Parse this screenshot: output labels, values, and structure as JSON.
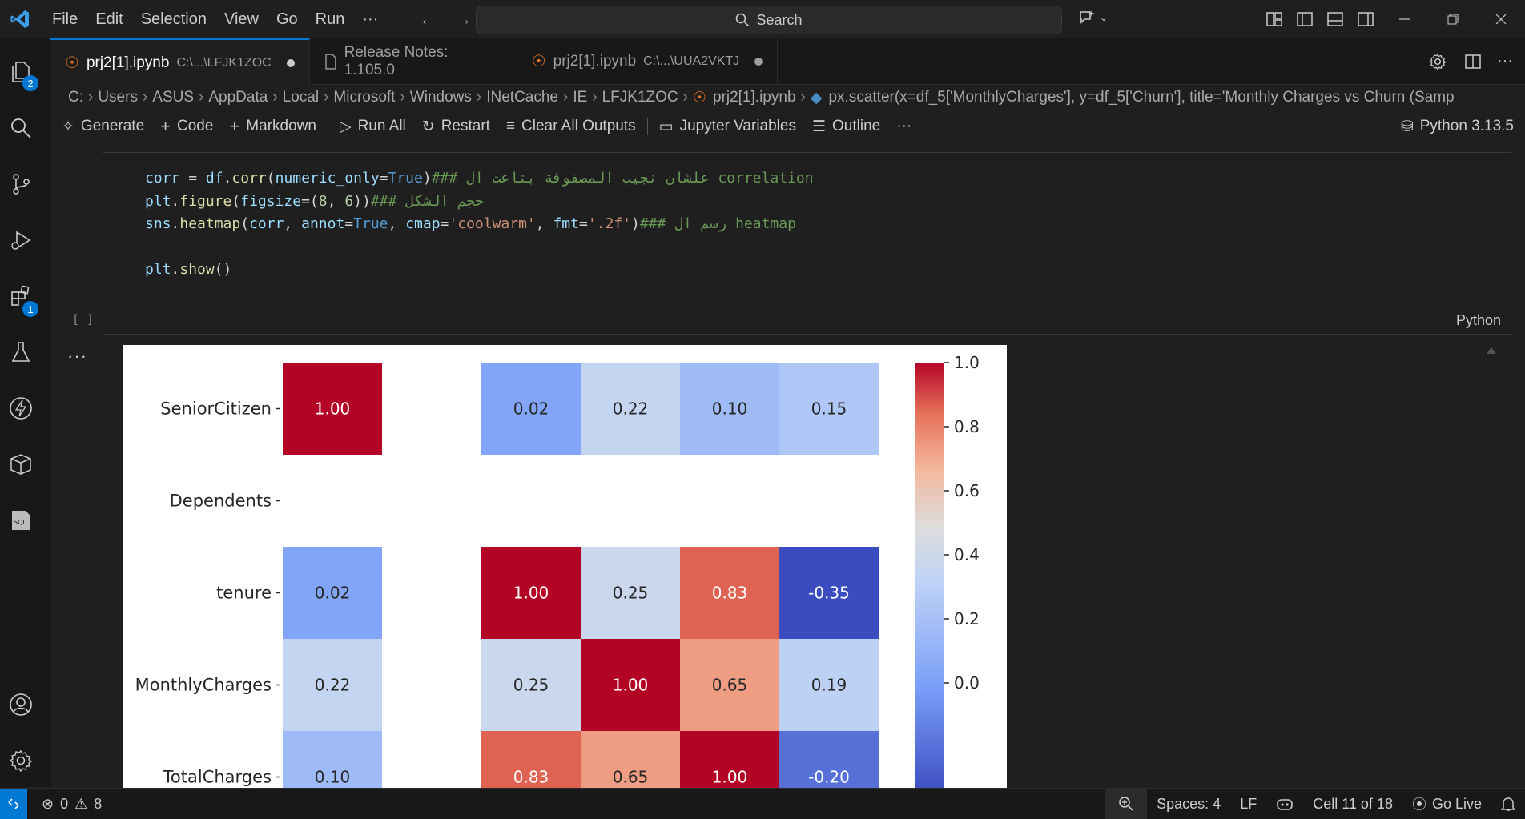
{
  "titlebar": {
    "menu": [
      "File",
      "Edit",
      "Selection",
      "View",
      "Go",
      "Run",
      "···"
    ],
    "search_placeholder": "Search"
  },
  "activity_badges": {
    "explorer": "2",
    "extensions": "1"
  },
  "tabs": [
    {
      "name": "prj2[1].ipynb",
      "path": "C:\\...\\LFJK1ZOC",
      "active": true,
      "modified": true
    },
    {
      "name": "Release Notes: 1.105.0",
      "path": "",
      "active": false,
      "modified": false
    },
    {
      "name": "prj2[1].ipynb",
      "path": "C:\\...\\UUA2VKTJ",
      "active": false,
      "modified": true
    }
  ],
  "breadcrumb": [
    "C:",
    "Users",
    "ASUS",
    "AppData",
    "Local",
    "Microsoft",
    "Windows",
    "INetCache",
    "IE",
    "LFJK1ZOC",
    "prj2[1].ipynb",
    "px.scatter(x=df_5['MonthlyCharges'], y=df_5['Churn'], title='Monthly Charges vs Churn (Samp"
  ],
  "notebook_toolbar": {
    "generate": "Generate",
    "code": "Code",
    "markdown": "Markdown",
    "run_all": "Run All",
    "restart": "Restart",
    "clear_outputs": "Clear All Outputs",
    "variables": "Jupyter Variables",
    "outline": "Outline",
    "more": "···",
    "kernel": "Python 3.13.5"
  },
  "cell": {
    "execution_count": "[ ]",
    "language": "Python",
    "code_lines": [
      "corr = df.corr(numeric_only=True)### علشان نجيب المصفوفة بتاعت ال correlation",
      "plt.figure(figsize=(8, 6))### حجم الشكل",
      "sns.heatmap(corr, annot=True, cmap='coolwarm', fmt='.2f')### رسم ال heatmap",
      "",
      "plt.show()"
    ]
  },
  "output_more": "···",
  "chart_data": {
    "type": "heatmap",
    "rows": [
      "SeniorCitizen",
      "Dependents",
      "tenure",
      "MonthlyCharges",
      "TotalCharges"
    ],
    "column_count_visible": 5,
    "cells": [
      [
        1.0,
        null,
        0.02,
        0.22,
        0.1,
        0.15
      ],
      [
        null,
        null,
        null,
        null,
        null,
        null
      ],
      [
        0.02,
        null,
        1.0,
        0.25,
        0.83,
        -0.35
      ],
      [
        0.22,
        null,
        0.25,
        1.0,
        0.65,
        0.19
      ],
      [
        0.1,
        null,
        0.83,
        0.65,
        1.0,
        -0.2
      ]
    ],
    "colormap": "coolwarm",
    "colorbar_ticks": [
      "1.0",
      "0.8",
      "0.6",
      "0.4",
      "0.2",
      "0.0"
    ],
    "colorbar_range": [
      -0.35,
      1.0
    ],
    "annotation_format": ".2f"
  },
  "statusbar": {
    "errors": "0",
    "warnings": "8",
    "spaces": "Spaces: 4",
    "eol": "LF",
    "cell": "Cell 11 of 18",
    "golive": "Go Live"
  },
  "colors": {
    "accent": "#0078d4",
    "background": "#1f1f1f"
  }
}
